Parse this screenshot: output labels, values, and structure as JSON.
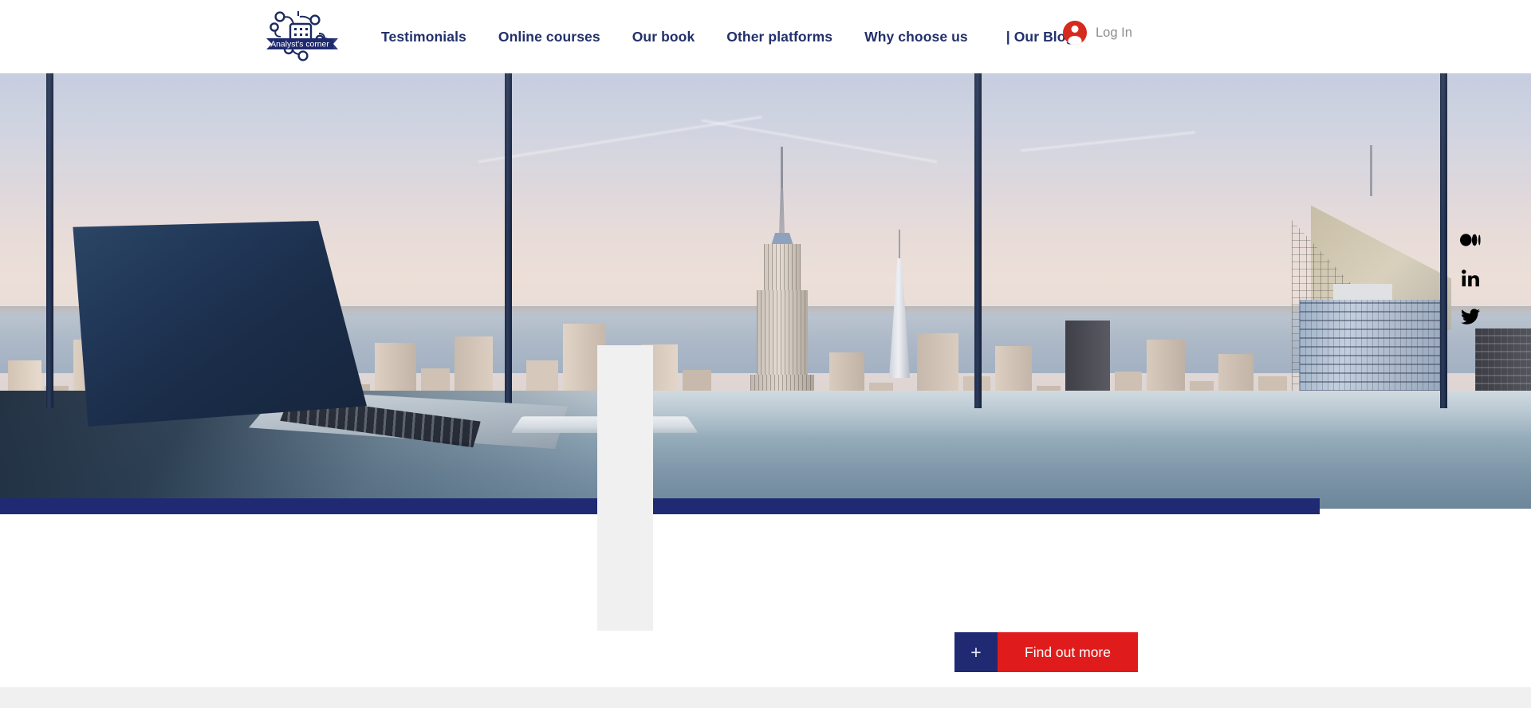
{
  "site": {
    "brand_name": "Analyst's corner",
    "logo_icon": "network-building-logo"
  },
  "header": {
    "nav_items": [
      {
        "label": "Testimonials",
        "name": "testimonials"
      },
      {
        "label": "Online courses",
        "name": "online-courses"
      },
      {
        "label": "Our book",
        "name": "our-book"
      },
      {
        "label": "Other platforms",
        "name": "other-platforms"
      },
      {
        "label": "Why choose us",
        "name": "why-choose-us"
      },
      {
        "label": "| Our Blog",
        "name": "our-blog"
      }
    ],
    "login": {
      "label": "Log In",
      "avatar_icon": "user-avatar-icon",
      "avatar_color": "#d52b1e",
      "label_color": "#8d8d8d"
    },
    "nav_color": "#22306b",
    "background": "#ffffff"
  },
  "hero": {
    "name": "hero-banner",
    "alt": "Laptop on a desk in front of a floor-to-ceiling window overlooking the New York City skyline",
    "accent_bar_color": "#1f2a73",
    "placeholder_color": "#f0f0f0"
  },
  "social": {
    "items": [
      {
        "label": "Medium",
        "icon": "medium-icon",
        "name": "social-medium"
      },
      {
        "label": "LinkedIn",
        "icon": "linkedin-icon",
        "name": "social-linkedin"
      },
      {
        "label": "Twitter",
        "icon": "twitter-icon",
        "name": "social-twitter"
      }
    ],
    "color": "#000000"
  },
  "cta": {
    "plus_label": "+",
    "label": "Find out more",
    "plus_bg": "#1f2a73",
    "label_bg": "#e01b1b",
    "text_color": "#ffffff"
  },
  "footer": {
    "background": "#f0f0f0"
  }
}
